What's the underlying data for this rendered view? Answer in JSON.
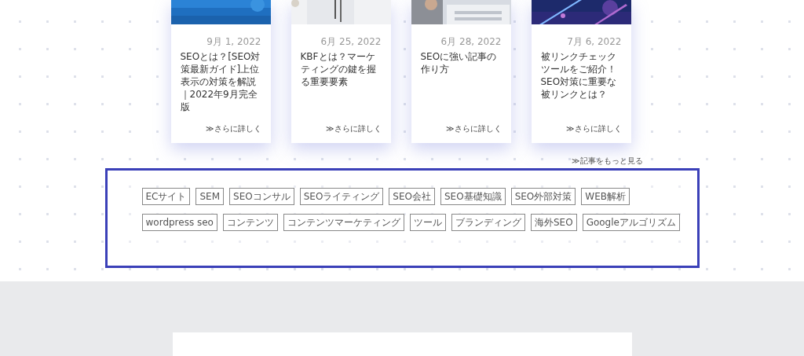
{
  "posts": [
    {
      "kind": "picture",
      "date": "9月 1, 2022",
      "title": "SEOとは？[SEO対策最新ガイド]上位表示の対策を解説｜2022年9月完全版",
      "more": "≫さらに詳しく"
    },
    {
      "kind": "picture",
      "date": "6月 25, 2022",
      "title": "KBFとは？マーケティングの鍵を握る重要要素",
      "more": "≫さらに詳しく"
    },
    {
      "kind": "picture",
      "date": "6月 28, 2022",
      "title": "SEOに強い記事の作り方",
      "more": "≫さらに詳しく"
    },
    {
      "kind": "picture",
      "date": "7月 6, 2022",
      "title": "被リンクチェックツールをご紹介！SEO対策に重要な被リンクとは？",
      "more": "≫さらに詳しく"
    }
  ],
  "more_link": "≫記事をもっと見る",
  "tag_rows": [
    [
      "ECサイト",
      "SEM",
      "SEOコンサル",
      "SEOライティング",
      "SEO会社",
      "SEO基礎知識",
      "SEO外部対策",
      "WEB解析"
    ],
    [
      "wordpress seo",
      "コンテンツ",
      "コンテンツマーケティング",
      "ツール",
      "ブランディング",
      "海外SEO",
      "Googleアルゴリズム"
    ]
  ]
}
